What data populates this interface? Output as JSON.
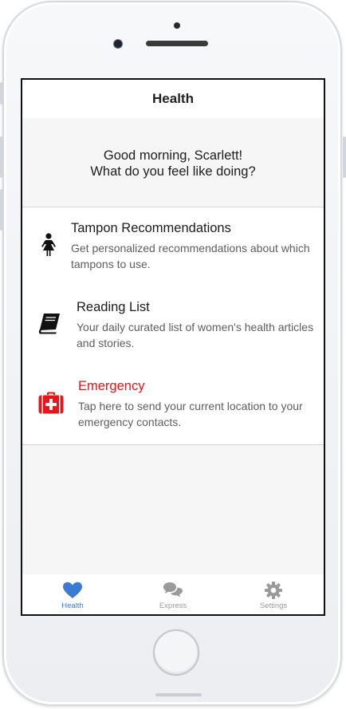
{
  "navbar": {
    "title": "Health"
  },
  "greeting": {
    "line1": "Good morning, Scarlett!",
    "line2": "What do you feel like doing?"
  },
  "items": [
    {
      "title": "Tampon Recommendations",
      "description": "Get personalized recommendations about which tampons to use.",
      "icon": "woman-icon"
    },
    {
      "title": "Reading List",
      "description": "Your daily curated list of women's health articles and stories.",
      "icon": "book-icon"
    },
    {
      "title": "Emergency",
      "description": "Tap here to send your current location to your emergency contacts.",
      "icon": "first-aid-kit-icon"
    }
  ],
  "tabbar": {
    "tabs": [
      {
        "label": "Health",
        "icon": "heart-icon",
        "active": true
      },
      {
        "label": "Express",
        "icon": "chat-bubbles-icon",
        "active": false
      },
      {
        "label": "Settings",
        "icon": "gear-icon",
        "active": false
      }
    ]
  },
  "colors": {
    "accent": "#3b7bd4",
    "emergency": "#e8151b",
    "inactive_tab": "#9a9a9a"
  }
}
